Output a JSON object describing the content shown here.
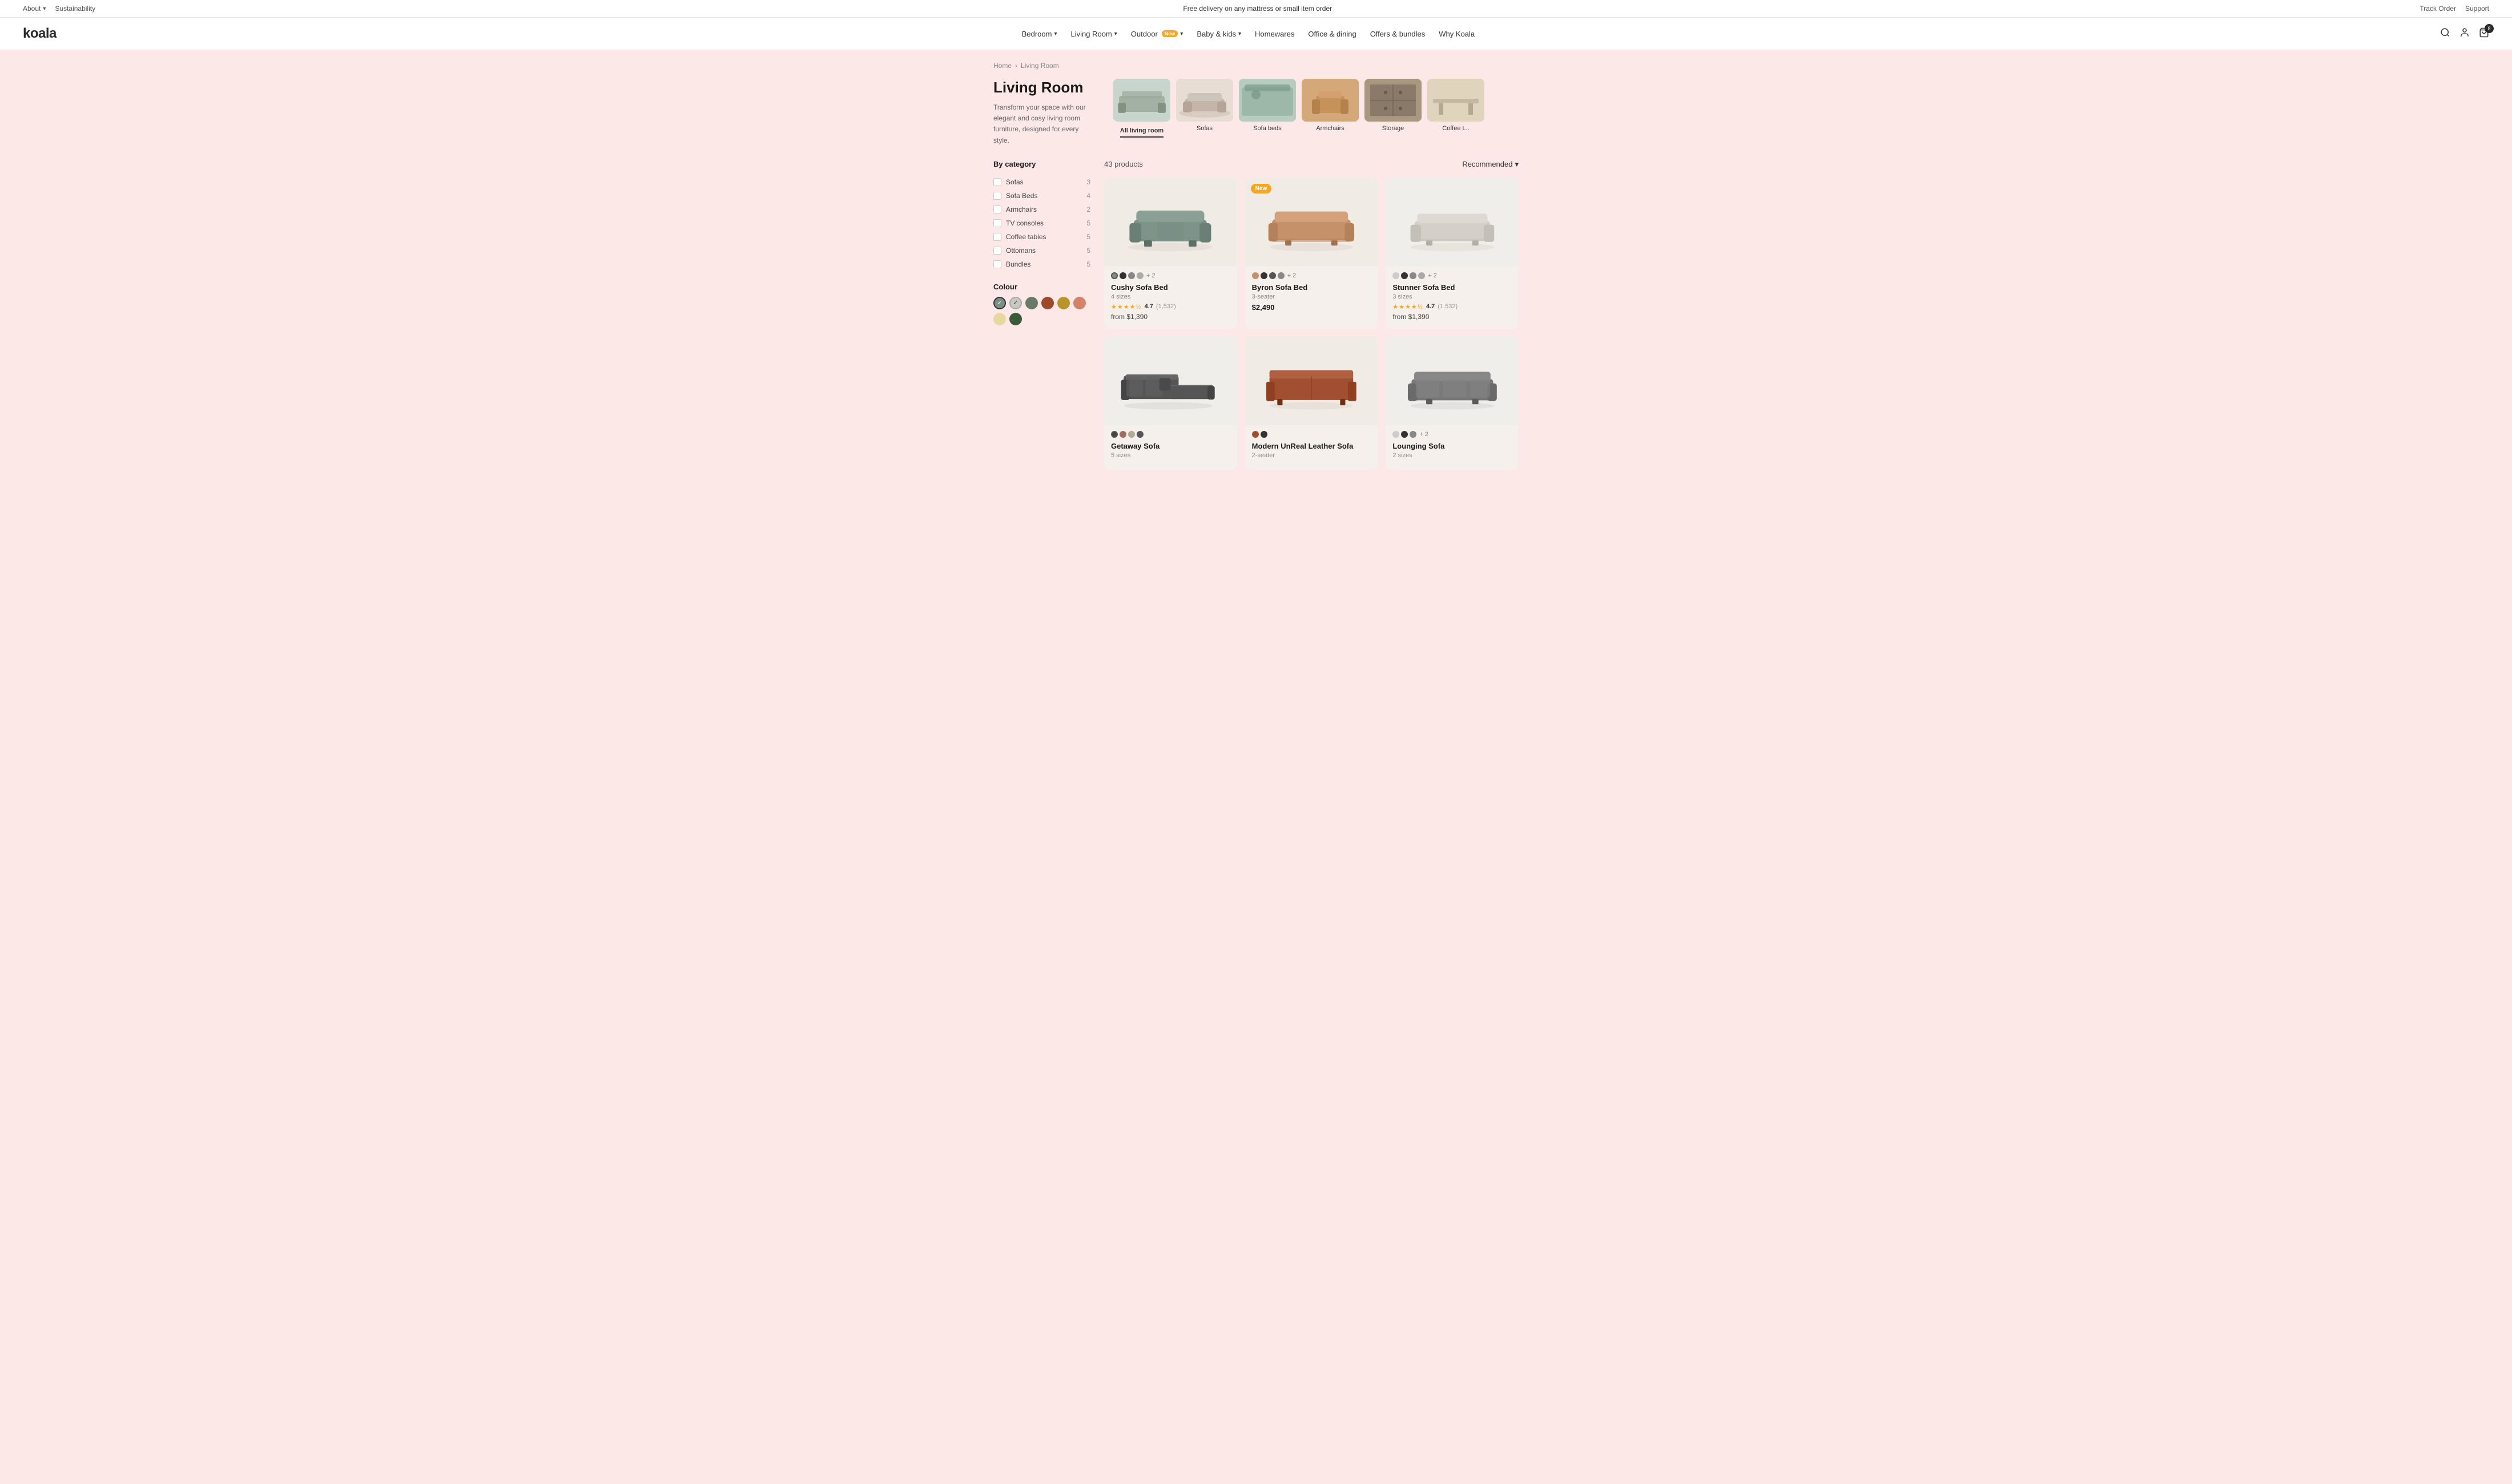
{
  "topBar": {
    "left": [
      {
        "label": "About",
        "hasDropdown": true
      },
      {
        "label": "Sustainability"
      }
    ],
    "center": "Free delivery on any mattress or small item order",
    "right": [
      {
        "label": "Track Order"
      },
      {
        "label": "Support"
      }
    ]
  },
  "header": {
    "logo": "koala",
    "nav": [
      {
        "label": "Bedroom",
        "hasDropdown": true
      },
      {
        "label": "Living Room",
        "hasDropdown": true
      },
      {
        "label": "Outdoor",
        "hasDropdown": true,
        "badge": "New"
      },
      {
        "label": "Baby & kids",
        "hasDropdown": true
      },
      {
        "label": "Homewares"
      },
      {
        "label": "Office & dining"
      },
      {
        "label": "Offers & bundles"
      },
      {
        "label": "Why Koala"
      }
    ],
    "cartCount": "8"
  },
  "breadcrumb": {
    "home": "Home",
    "current": "Living Room"
  },
  "pageHeader": {
    "title": "Living Room",
    "description": "Transform your space with our elegant and cosy living room furniture, designed for every style."
  },
  "categories": [
    {
      "label": "All living room",
      "active": true,
      "bgClass": "cat-img-all"
    },
    {
      "label": "Sofas",
      "active": false,
      "bgClass": "cat-img-sofas"
    },
    {
      "label": "Sofa beds",
      "active": false,
      "bgClass": "cat-img-sofa-beds"
    },
    {
      "label": "Armchairs",
      "active": false,
      "bgClass": "cat-img-armchairs"
    },
    {
      "label": "Storage",
      "active": false,
      "bgClass": "cat-img-storage"
    },
    {
      "label": "Coffee t...",
      "active": false,
      "bgClass": "cat-img-coffee"
    }
  ],
  "filters": {
    "categoryTitle": "By category",
    "items": [
      {
        "label": "Sofas",
        "count": "3"
      },
      {
        "label": "Sofa Beds",
        "count": "4"
      },
      {
        "label": "Armchairs",
        "count": "2"
      },
      {
        "label": "TV consoles",
        "count": "5"
      },
      {
        "label": "Coffee tables",
        "count": "5"
      },
      {
        "label": "Ottomans",
        "count": "5"
      },
      {
        "label": "Bundles",
        "count": "5"
      }
    ],
    "colourTitle": "Colour",
    "colours": [
      {
        "hex": "#7a8f85",
        "selected": true,
        "lightSelected": false
      },
      {
        "hex": "#c8c8c0",
        "selected": false,
        "lightSelected": true
      },
      {
        "hex": "#6a7a68",
        "selected": false,
        "lightSelected": false
      },
      {
        "hex": "#9e4a2a",
        "selected": false,
        "lightSelected": false
      },
      {
        "hex": "#b8942a",
        "selected": false,
        "lightSelected": false
      },
      {
        "hex": "#d4826a",
        "selected": false,
        "lightSelected": false
      },
      {
        "hex": "#e8d8a0",
        "selected": false,
        "lightSelected": false
      },
      {
        "hex": "#3a5a38",
        "selected": false,
        "lightSelected": false
      }
    ]
  },
  "products": {
    "count": "43 products",
    "sortLabel": "Recommended",
    "items": [
      {
        "name": "Cushy Sofa Bed",
        "size": "4 sizes",
        "rating": "4.7",
        "ratingCount": "(1,532)",
        "price": "from $1,390",
        "priceRaw": "",
        "badge": "",
        "bgClass": "product-img-bg-cream",
        "colours": [
          "#7a8f85",
          "#555",
          "#888",
          "#aaa"
        ],
        "moreColours": "+ 2",
        "sofaColor": "#7a8f85"
      },
      {
        "name": "Byron Sofa Bed",
        "size": "3-seater",
        "rating": "",
        "ratingCount": "",
        "price": "$2,490",
        "priceRaw": "$2,490",
        "badge": "New",
        "bgClass": "product-img-bg-cream",
        "colours": [
          "#c4916a",
          "#333",
          "#555",
          "#888"
        ],
        "moreColours": "+ 2",
        "sofaColor": "#c4916a"
      },
      {
        "name": "Stunner Sofa Bed",
        "size": "3 sizes",
        "rating": "4.7",
        "ratingCount": "(1,532)",
        "price": "from $1,390",
        "priceRaw": "",
        "badge": "",
        "bgClass": "product-img-bg-light",
        "colours": [
          "#ccc",
          "#333",
          "#888",
          "#aaa"
        ],
        "moreColours": "+ 2",
        "sofaColor": "#d4d0c8"
      },
      {
        "name": "Getaway Sofa",
        "size": "5 sizes",
        "rating": "",
        "ratingCount": "",
        "price": "",
        "priceRaw": "",
        "badge": "",
        "bgClass": "product-img-bg-light",
        "colours": [
          "#444",
          "#a07060",
          "#b0a898",
          "#555"
        ],
        "moreColours": "",
        "sofaColor": "#555"
      },
      {
        "name": "Modern UnReal Leather Sofa",
        "size": "2-seater",
        "rating": "",
        "ratingCount": "",
        "price": "",
        "priceRaw": "",
        "badge": "",
        "bgClass": "product-img-bg-cream",
        "colours": [
          "#a05030",
          "#333"
        ],
        "moreColours": "",
        "sofaColor": "#a05030"
      },
      {
        "name": "Lounging Sofa",
        "size": "2 sizes",
        "rating": "",
        "ratingCount": "",
        "price": "",
        "priceRaw": "",
        "badge": "",
        "bgClass": "product-img-bg-light",
        "colours": [
          "#ccc",
          "#333",
          "#888"
        ],
        "moreColours": "+ 2",
        "sofaColor": "#888"
      }
    ]
  }
}
